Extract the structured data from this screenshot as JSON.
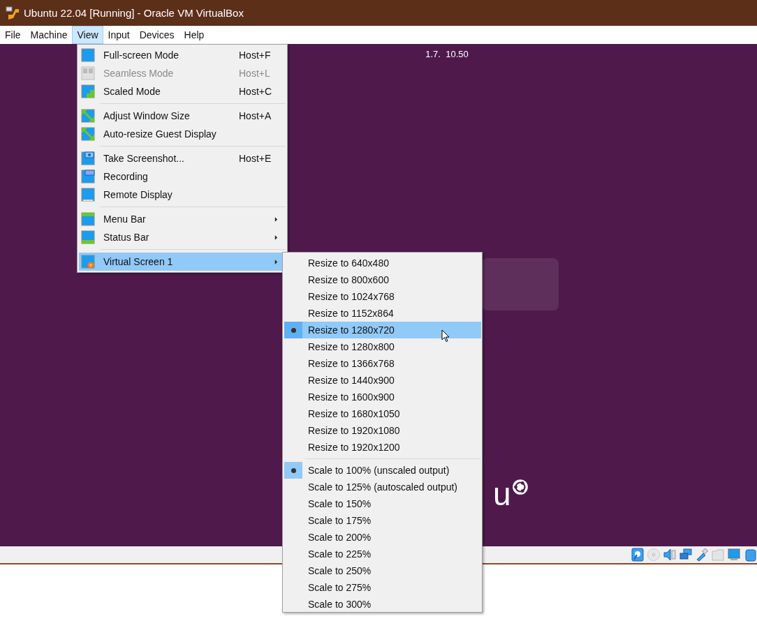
{
  "title_bar": {
    "title": "Ubuntu 22.04 [Running] - Oracle VM VirtualBox"
  },
  "menu_bar": [
    {
      "label": "File",
      "selected": false
    },
    {
      "label": "Machine",
      "selected": false
    },
    {
      "label": "View",
      "selected": true
    },
    {
      "label": "Input",
      "selected": false
    },
    {
      "label": "Devices",
      "selected": false
    },
    {
      "label": "Help",
      "selected": false
    }
  ],
  "guest_screen": {
    "clock": "1.7.  10.50",
    "logo_text": "u"
  },
  "view_menu": {
    "sections": [
      [
        {
          "kind": "fullscreen",
          "label": "Full-screen Mode",
          "shortcut": "Host+F",
          "disabled": false,
          "submenu": false,
          "highlighted": false
        },
        {
          "kind": "seamless",
          "label": "Seamless Mode",
          "shortcut": "Host+L",
          "disabled": true,
          "submenu": false,
          "highlighted": false
        },
        {
          "kind": "scaled",
          "label": "Scaled Mode",
          "shortcut": "Host+C",
          "disabled": false,
          "submenu": false,
          "highlighted": false
        }
      ],
      [
        {
          "kind": "adjust",
          "label": "Adjust Window Size",
          "shortcut": "Host+A",
          "disabled": false,
          "submenu": false,
          "highlighted": false
        },
        {
          "kind": "adjust",
          "label": "Auto-resize Guest Display",
          "disabled": false,
          "submenu": false,
          "highlighted": false
        }
      ],
      [
        {
          "kind": "screenshot",
          "label": "Take Screenshot...",
          "shortcut": "Host+E",
          "disabled": false,
          "submenu": false,
          "highlighted": false
        },
        {
          "kind": "recording",
          "label": "Recording",
          "disabled": false,
          "submenu": false,
          "highlighted": false
        },
        {
          "kind": "remote",
          "label": "Remote Display",
          "disabled": false,
          "submenu": false,
          "highlighted": false
        }
      ],
      [
        {
          "kind": "menubar",
          "label": "Menu Bar",
          "disabled": false,
          "submenu": true,
          "highlighted": false
        },
        {
          "kind": "statusbar",
          "label": "Status Bar",
          "disabled": false,
          "submenu": true,
          "highlighted": false
        }
      ],
      [
        {
          "kind": "virtualscreen",
          "label": "Virtual Screen 1",
          "disabled": false,
          "submenu": true,
          "highlighted": true
        }
      ]
    ]
  },
  "virtual_screen_menu": {
    "sections": [
      [
        {
          "label": "Resize to 640x480",
          "checked": false,
          "highlighted": false
        },
        {
          "label": "Resize to 800x600",
          "checked": false,
          "highlighted": false
        },
        {
          "label": "Resize to 1024x768",
          "checked": false,
          "highlighted": false
        },
        {
          "label": "Resize to 1152x864",
          "checked": false,
          "highlighted": false
        },
        {
          "label": "Resize to 1280x720",
          "checked": true,
          "highlighted": true
        },
        {
          "label": "Resize to 1280x800",
          "checked": false,
          "highlighted": false
        },
        {
          "label": "Resize to 1366x768",
          "checked": false,
          "highlighted": false
        },
        {
          "label": "Resize to 1440x900",
          "checked": false,
          "highlighted": false
        },
        {
          "label": "Resize to 1600x900",
          "checked": false,
          "highlighted": false
        },
        {
          "label": "Resize to 1680x1050",
          "checked": false,
          "highlighted": false
        },
        {
          "label": "Resize to 1920x1080",
          "checked": false,
          "highlighted": false
        },
        {
          "label": "Resize to 1920x1200",
          "checked": false,
          "highlighted": false
        }
      ],
      [
        {
          "label": "Scale to 100% (unscaled output)",
          "checked": true,
          "highlighted": false
        },
        {
          "label": "Scale to 125% (autoscaled output)",
          "checked": false,
          "highlighted": false
        },
        {
          "label": "Scale to 150%",
          "checked": false,
          "highlighted": false
        },
        {
          "label": "Scale to 175%",
          "checked": false,
          "highlighted": false
        },
        {
          "label": "Scale to 200%",
          "checked": false,
          "highlighted": false
        },
        {
          "label": "Scale to 225%",
          "checked": false,
          "highlighted": false
        },
        {
          "label": "Scale to 250%",
          "checked": false,
          "highlighted": false
        },
        {
          "label": "Scale to 275%",
          "checked": false,
          "highlighted": false
        },
        {
          "label": "Scale to 300%",
          "checked": false,
          "highlighted": false
        }
      ]
    ]
  }
}
